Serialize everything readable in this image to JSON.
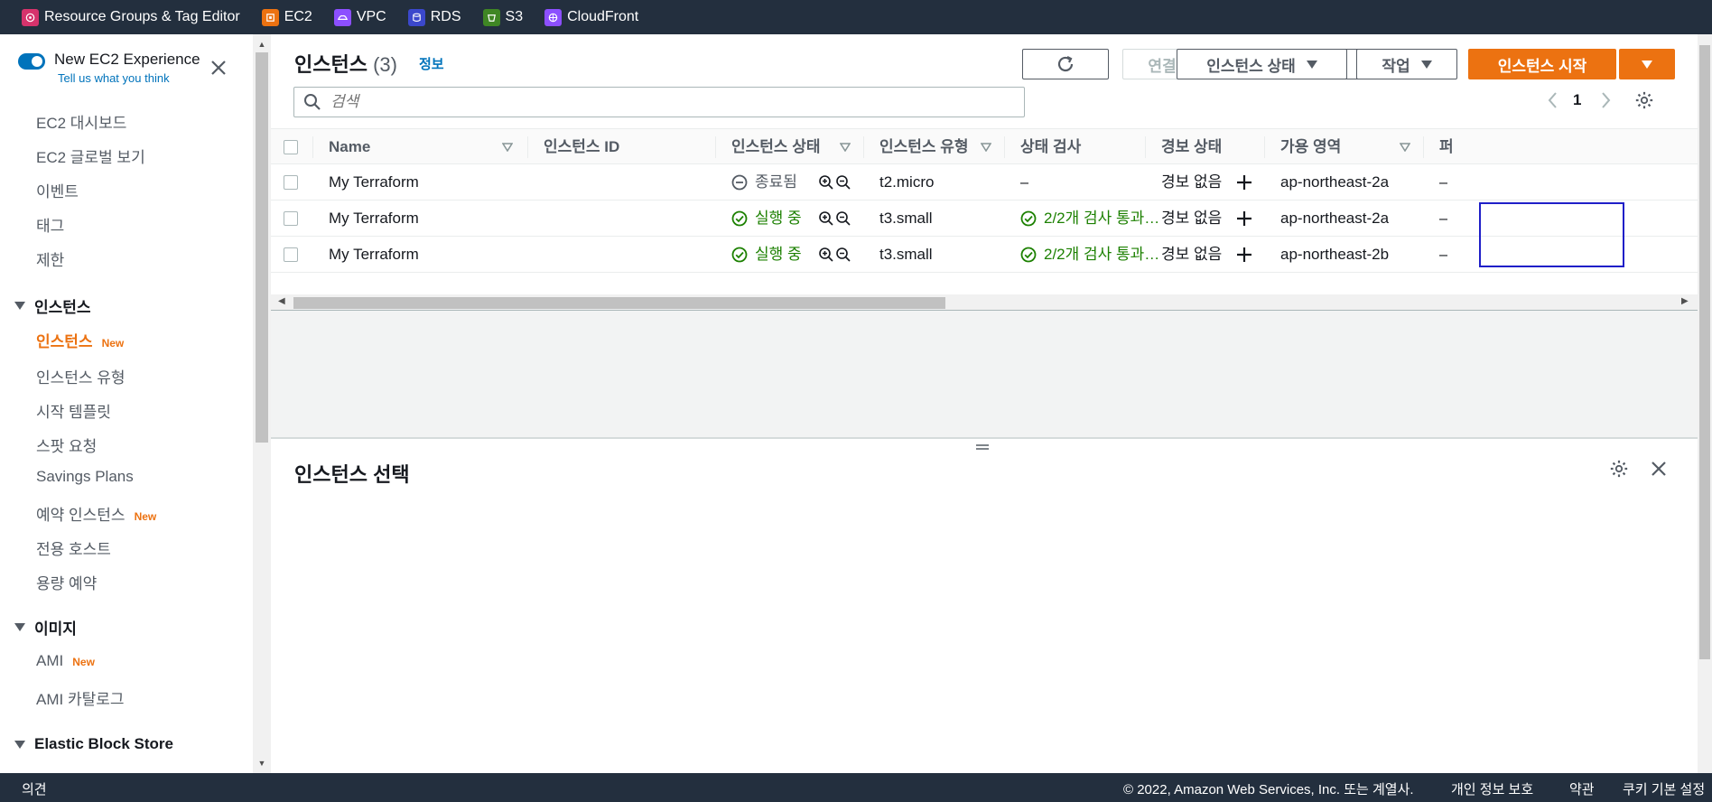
{
  "top_services": [
    {
      "label": "Resource Groups & Tag Editor",
      "icon": "resource-groups-icon",
      "color": "#d6336c"
    },
    {
      "label": "EC2",
      "icon": "ec2-icon",
      "color": "#ec7211"
    },
    {
      "label": "VPC",
      "icon": "vpc-icon",
      "color": "#8c4fff"
    },
    {
      "label": "RDS",
      "icon": "rds-icon",
      "color": "#3b48cc"
    },
    {
      "label": "S3",
      "icon": "s3-icon",
      "color": "#3f8624"
    },
    {
      "label": "CloudFront",
      "icon": "cloudfront-icon",
      "color": "#8c4fff"
    }
  ],
  "sidebar": {
    "toggle_title": "New EC2 Experience",
    "toggle_sub": "Tell us what you think",
    "items": [
      {
        "label": "EC2 대시보드"
      },
      {
        "label": "EC2 글로벌 보기"
      },
      {
        "label": "이벤트"
      },
      {
        "label": "태그"
      },
      {
        "label": "제한"
      }
    ],
    "section_instances": "인스턴스",
    "instances_items": [
      {
        "label": "인스턴스",
        "badge": "New"
      },
      {
        "label": "인스턴스 유형"
      },
      {
        "label": "시작 템플릿"
      },
      {
        "label": "스팟 요청"
      },
      {
        "label": "Savings Plans"
      },
      {
        "label": "예약 인스턴스",
        "badge": "New"
      },
      {
        "label": "전용 호스트"
      },
      {
        "label": "용량 예약"
      }
    ],
    "section_images": "이미지",
    "images_items": [
      {
        "label": "AMI",
        "badge": "New"
      },
      {
        "label": "AMI 카탈로그"
      }
    ],
    "section_ebs": "Elastic Block Store"
  },
  "main": {
    "title": "인스턴스",
    "count": "(3)",
    "info": "정보",
    "buttons": {
      "connect": "연결",
      "instance_state": "인스턴스 상태",
      "actions": "작업",
      "launch": "인스턴스 시작"
    },
    "search_placeholder": "검색",
    "page": "1",
    "columns": [
      "Name",
      "인스턴스 ID",
      "인스턴스 상태",
      "인스턴스 유형",
      "상태 검사",
      "경보 상태",
      "가용 영역",
      "퍼"
    ],
    "rows": [
      {
        "name": "My Terraform",
        "id": "",
        "state": "종료됨",
        "state_kind": "stopped",
        "type": "t2.micro",
        "check": "–",
        "check_ok": false,
        "alarm": "경보 없음",
        "az": "ap-northeast-2a",
        "extra": "–"
      },
      {
        "name": "My Terraform",
        "id": "",
        "state": "실행 중",
        "state_kind": "running",
        "type": "t3.small",
        "check": "2/2개 검사 통과…",
        "check_ok": true,
        "alarm": "경보 없음",
        "az": "ap-northeast-2a",
        "extra": "–"
      },
      {
        "name": "My Terraform",
        "id": "",
        "state": "실행 중",
        "state_kind": "running",
        "type": "t3.small",
        "check": "2/2개 검사 통과…",
        "check_ok": true,
        "alarm": "경보 없음",
        "az": "ap-northeast-2b",
        "extra": "–"
      }
    ],
    "detail_title": "인스턴스 선택"
  },
  "footer": {
    "feedback": "의견",
    "copyright": "© 2022, Amazon Web Services, Inc. 또는 계열사.",
    "privacy": "개인 정보 보호",
    "terms": "약관",
    "cookies": "쿠키 기본 설정"
  },
  "colors": {
    "accent": "#ec7211",
    "link": "#0073bb",
    "running": "#1d8102",
    "nav_bg": "#232f3e",
    "highlight": "#1f1fc8"
  }
}
